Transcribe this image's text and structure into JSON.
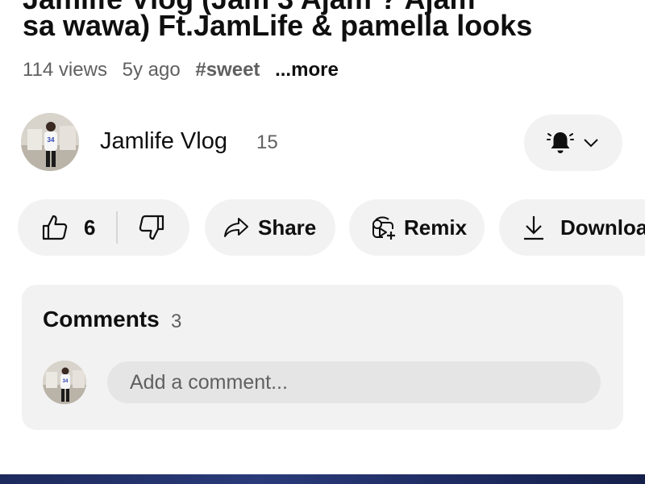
{
  "video": {
    "title_line1": "Jamlife Vlog (Jam 3 Ajam ? Ajam",
    "title_line2": "sa wawa) Ft.JamLife & pamella looks",
    "views": "114 views",
    "age": "5y ago",
    "hashtag": "#sweet",
    "more_label": "...more"
  },
  "channel": {
    "name": "Jamlife Vlog",
    "subscribers": "15"
  },
  "actions": {
    "like_count": "6",
    "share_label": "Share",
    "remix_label": "Remix",
    "download_label": "Download"
  },
  "comments": {
    "title": "Comments",
    "count": "3",
    "placeholder": "Add a comment..."
  },
  "icons": {
    "bell": "bell-icon",
    "chevron": "chevron-down-icon",
    "like": "thumbs-up-icon",
    "dislike": "thumbs-down-icon",
    "share": "share-icon",
    "remix": "remix-icon",
    "download": "download-icon"
  },
  "colors": {
    "pill_background": "#f2f2f2",
    "secondary_text": "#606060",
    "primary_text": "#0f0f0f"
  }
}
